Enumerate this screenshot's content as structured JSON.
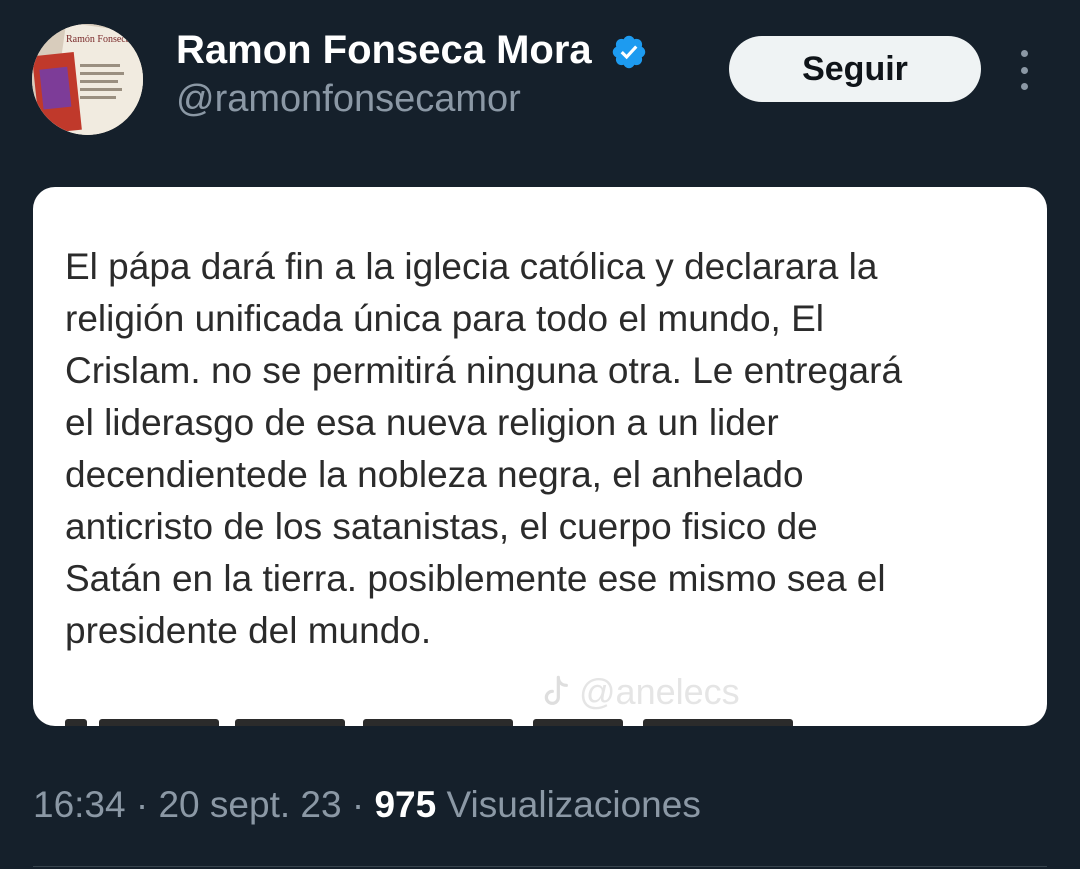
{
  "author": {
    "display_name": "Ramon Fonseca Mora",
    "handle": "@ramonfonsecamor",
    "avatar_text": "Ramón Fonseca",
    "verified_icon": "verified-badge-icon",
    "verified_color": "#1d9bf0"
  },
  "actions": {
    "follow_label": "Seguir",
    "more_icon": "more-vertical-icon"
  },
  "media": {
    "text": "El pápa dará fin a la iglecia católica y declarara la\nreligión unificada única para todo el mundo, El\nCrislam. no se permitirá ninguna otra. Le entregará\nel liderasgo de esa nueva religion a un lider\ndecendientede la nobleza negra, el anhelado\nanticristo de los satanistas, el cuerpo fisico de\nSatán en la tierra. posiblemente  ese mismo sea el\npresidente del mundo.",
    "watermark": "@anelecs",
    "watermark_icon": "tiktok-icon"
  },
  "meta": {
    "time": "16:34",
    "separator": " · ",
    "date": "20 sept. 23",
    "views_count": "975",
    "views_label": " Visualizaciones"
  },
  "colors": {
    "background": "#15202b",
    "text_primary": "#ffffff",
    "text_secondary": "#8b98a5",
    "button_bg": "#eff3f4"
  }
}
